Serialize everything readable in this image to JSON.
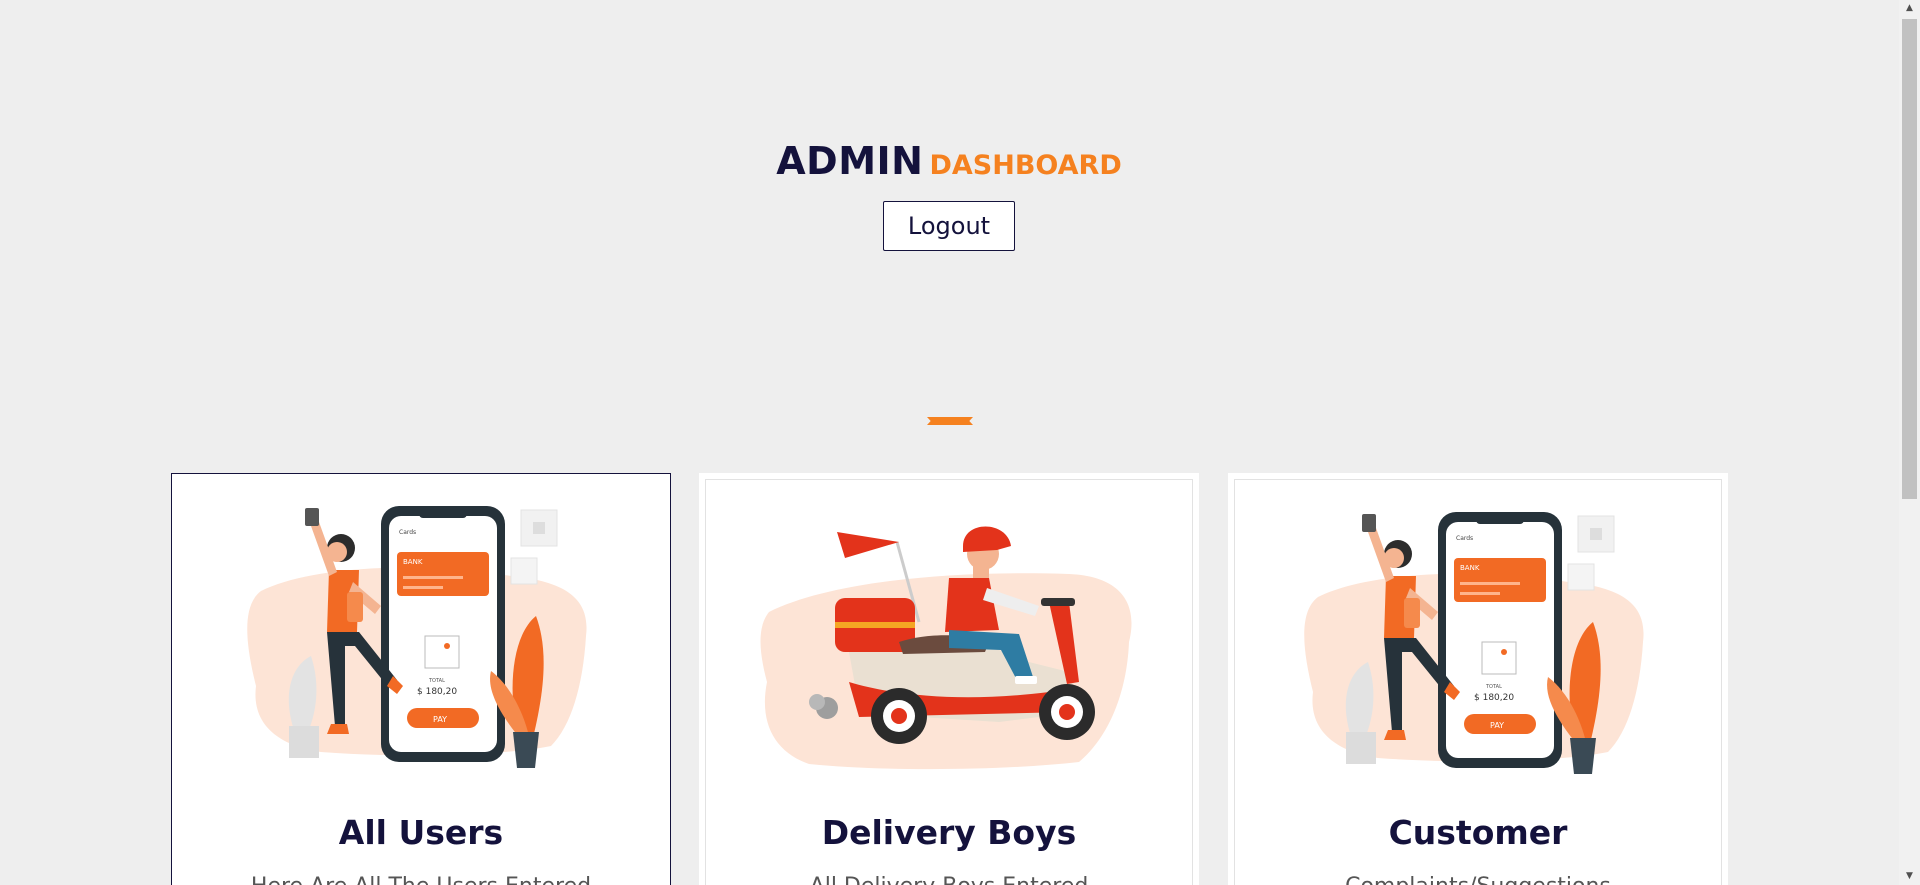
{
  "header": {
    "title_main": "ADMIN",
    "title_accent": "DASHBOARD",
    "logout_label": "Logout"
  },
  "cards": [
    {
      "title": "All Users",
      "description": "Here Are All The Users Entered",
      "image": "mobile-payment-illustration"
    },
    {
      "title": "Delivery Boys",
      "description": "All Delivery Boys Entered",
      "image": "scooter-delivery-illustration"
    },
    {
      "title": "Customer",
      "description": "Complaints/Suggestions",
      "image": "mobile-payment-illustration"
    }
  ],
  "colors": {
    "navy": "#14123c",
    "accent": "#f5811f",
    "background": "#eeeeee"
  },
  "phone": {
    "header": "Cards",
    "bank": "BANK",
    "total_label": "TOTAL",
    "total_value": "$ 180,20",
    "pay_label": "PAY"
  },
  "scrollbar": {
    "up_icon": "▲",
    "down_icon": "▼"
  }
}
